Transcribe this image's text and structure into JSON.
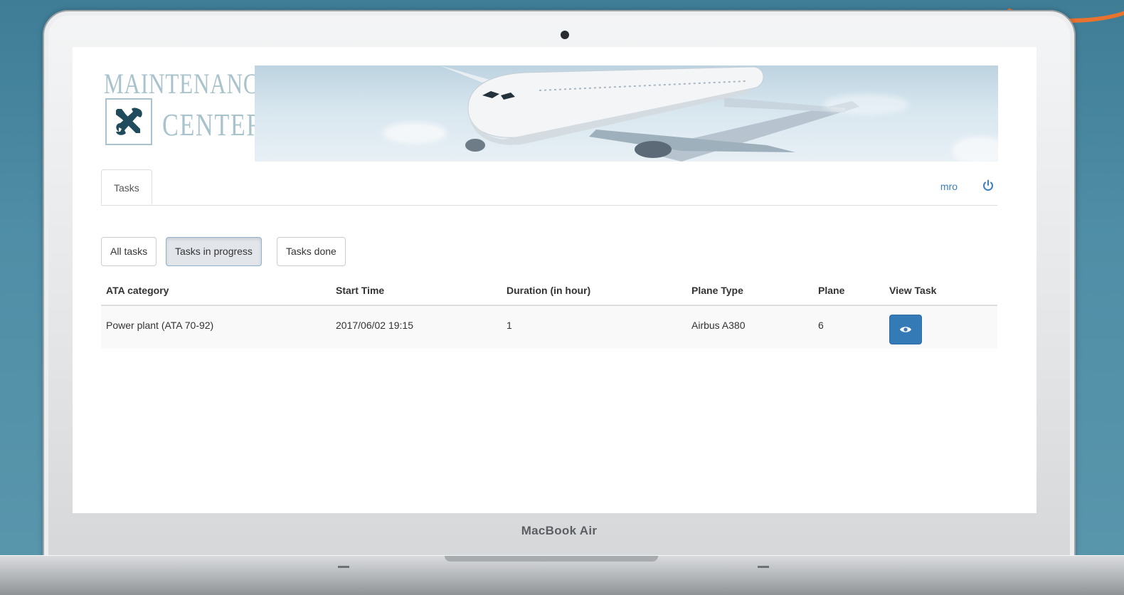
{
  "device": {
    "brand": "MacBook Air"
  },
  "app": {
    "logo": {
      "line1": "MAINTENANCE",
      "line2": "CENTER"
    },
    "nav": {
      "tabs": [
        {
          "label": "Tasks"
        }
      ],
      "user": "mro",
      "logout_icon": "power-icon"
    },
    "filters": [
      {
        "label": "All tasks",
        "active": false
      },
      {
        "label": "Tasks in progress",
        "active": true
      },
      {
        "label": "Tasks done",
        "active": false
      }
    ],
    "table": {
      "columns": [
        "ATA category",
        "Start Time",
        "Duration (in hour)",
        "Plane Type",
        "Plane",
        "View Task"
      ],
      "rows": [
        {
          "ata_category": "Power plant (ATA 70-92)",
          "start_time": "2017/06/02 19:15",
          "duration": "1",
          "plane_type": "Airbus A380",
          "plane": "6",
          "view_icon": "eye-icon"
        }
      ]
    },
    "colors": {
      "primary": "#337ab7",
      "link": "#3a7fc0",
      "logo": "#a9c3cc"
    }
  }
}
